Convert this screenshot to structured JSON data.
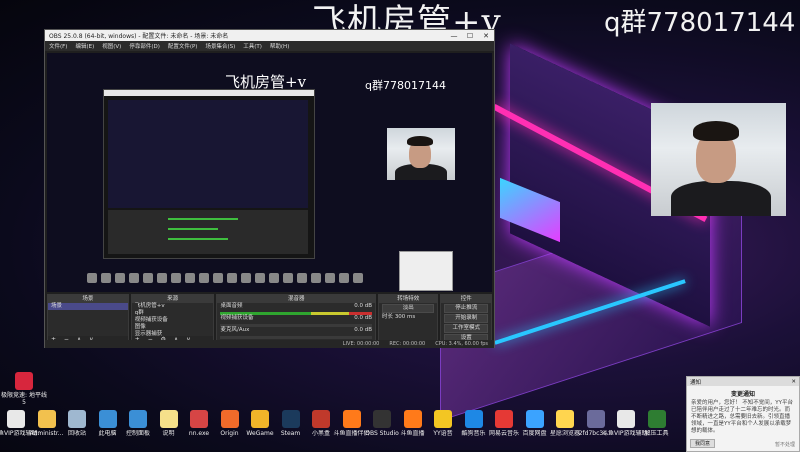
{
  "overlay": {
    "title": "飞机房管+v",
    "qq": "q群778017144"
  },
  "obs": {
    "title": "OBS 25.0.8 (64-bit, windows) - 配置文件: 未命名 - 场景: 未命名",
    "menu": [
      "文件(F)",
      "编辑(E)",
      "视图(V)",
      "停靠部件(D)",
      "配置文件(P)",
      "场景集合(S)",
      "工具(T)",
      "帮助(H)"
    ],
    "window_controls": [
      "—",
      "☐",
      "✕"
    ],
    "preview": {
      "inner_title": "飞机房管+v",
      "inner_qq": "q群778017144"
    },
    "docks": {
      "scenes": {
        "header": "场景",
        "items": [
          "场景"
        ],
        "footer": "+ − ∧ ∨"
      },
      "sources": {
        "header": "来源",
        "items": [
          "飞机房管+v",
          "q群",
          "视频捕获设备",
          "图像",
          "显示器捕获"
        ],
        "footer": "+ − ⚙ ∧ ∨"
      },
      "mixer": {
        "header": "混音器",
        "channels": [
          {
            "label": "桌面音频",
            "db": "0.0 dB"
          },
          {
            "label": "视频捕获设备",
            "db": "0.0 dB"
          },
          {
            "label": "麦克风/Aux",
            "db": "0.0 dB"
          }
        ]
      },
      "transitions": {
        "header": "转场特效",
        "type": "淡出",
        "duration_label": "时长",
        "duration": "300 ms"
      },
      "controls": {
        "header": "控件",
        "buttons": [
          "停止推流",
          "开始录制",
          "工作室模式",
          "设置",
          "退出"
        ]
      }
    },
    "status": {
      "live": "LIVE: 00:00:00",
      "rec": "REC: 00:00:00",
      "cpu": "CPU: 3.4%, 60.00 fps"
    }
  },
  "desktop_icons": [
    {
      "label": "斗鱼VIP游戏辅助.txt",
      "color": "#e8e8e8"
    },
    {
      "label": "Administr...",
      "color": "#f2c14e"
    },
    {
      "label": "回收站",
      "color": "#9fb8d0"
    },
    {
      "label": "此电脑",
      "color": "#3b8fd6"
    },
    {
      "label": "控制面板",
      "color": "#3b8fd6"
    },
    {
      "label": "说明",
      "color": "#f5e08a"
    },
    {
      "label": "nn.exe",
      "color": "#d64545"
    },
    {
      "label": "Origin",
      "color": "#f06a2a"
    },
    {
      "label": "WeGame",
      "color": "#f0b429"
    },
    {
      "label": "Steam",
      "color": "#1b3a5c"
    },
    {
      "label": "小黑盒",
      "color": "#c0392b"
    },
    {
      "label": "斗鱼直播伴侣",
      "color": "#ff7a1a"
    },
    {
      "label": "OBS Studio",
      "color": "#333"
    },
    {
      "label": "斗鱼直播",
      "color": "#ff7a1a"
    },
    {
      "label": "YY语音",
      "color": "#f3c623"
    },
    {
      "label": "酷狗音乐",
      "color": "#1e88e5"
    },
    {
      "label": "网易云音乐",
      "color": "#e53935"
    },
    {
      "label": "百度网盘",
      "color": "#3ba3ff"
    },
    {
      "label": "星愿浏览器",
      "color": "#ffd54f"
    },
    {
      "label": "2fd7bc3c...",
      "color": "#6b6b9b"
    },
    {
      "label": "斗鱼VIP游戏辅助.txt",
      "color": "#e8e8e8"
    },
    {
      "label": "解压工具",
      "color": "#2e7d32"
    }
  ],
  "corner_icon": {
    "label": "极限竞速: 地平线 5"
  },
  "popup": {
    "header": "通知",
    "title": "变更通知",
    "body": "亲爱的用户，您好！ 不知不觉间，YY平台已陪伴用户走过了十二年难忘的时光。而不断精进之路，总需要旧去新。引领直播领域，一直是YY平台和个人发展以承载梦想的载体。",
    "button": "我同意",
    "skip": "暂不处理"
  }
}
